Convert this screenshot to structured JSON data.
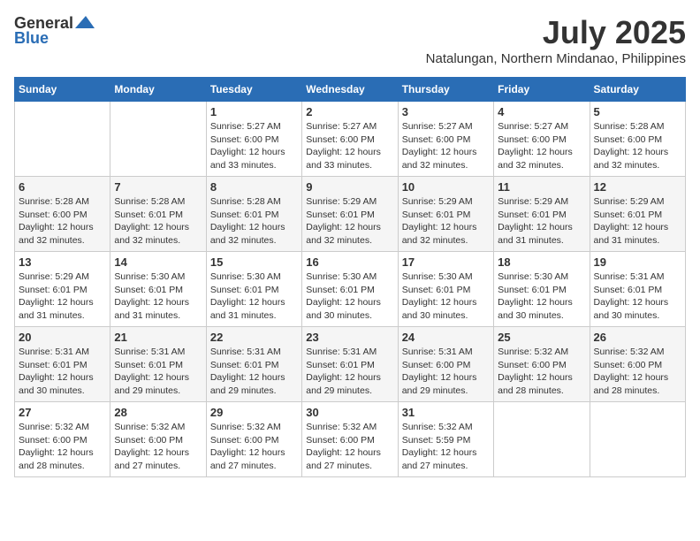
{
  "header": {
    "logo": {
      "general": "General",
      "blue": "Blue"
    },
    "title": "July 2025",
    "location": "Natalungan, Northern Mindanao, Philippines"
  },
  "weekdays": [
    "Sunday",
    "Monday",
    "Tuesday",
    "Wednesday",
    "Thursday",
    "Friday",
    "Saturday"
  ],
  "weeks": [
    [
      {
        "day": "",
        "info": ""
      },
      {
        "day": "",
        "info": ""
      },
      {
        "day": "1",
        "info": "Sunrise: 5:27 AM\nSunset: 6:00 PM\nDaylight: 12 hours and 33 minutes."
      },
      {
        "day": "2",
        "info": "Sunrise: 5:27 AM\nSunset: 6:00 PM\nDaylight: 12 hours and 33 minutes."
      },
      {
        "day": "3",
        "info": "Sunrise: 5:27 AM\nSunset: 6:00 PM\nDaylight: 12 hours and 32 minutes."
      },
      {
        "day": "4",
        "info": "Sunrise: 5:27 AM\nSunset: 6:00 PM\nDaylight: 12 hours and 32 minutes."
      },
      {
        "day": "5",
        "info": "Sunrise: 5:28 AM\nSunset: 6:00 PM\nDaylight: 12 hours and 32 minutes."
      }
    ],
    [
      {
        "day": "6",
        "info": "Sunrise: 5:28 AM\nSunset: 6:00 PM\nDaylight: 12 hours and 32 minutes."
      },
      {
        "day": "7",
        "info": "Sunrise: 5:28 AM\nSunset: 6:01 PM\nDaylight: 12 hours and 32 minutes."
      },
      {
        "day": "8",
        "info": "Sunrise: 5:28 AM\nSunset: 6:01 PM\nDaylight: 12 hours and 32 minutes."
      },
      {
        "day": "9",
        "info": "Sunrise: 5:29 AM\nSunset: 6:01 PM\nDaylight: 12 hours and 32 minutes."
      },
      {
        "day": "10",
        "info": "Sunrise: 5:29 AM\nSunset: 6:01 PM\nDaylight: 12 hours and 32 minutes."
      },
      {
        "day": "11",
        "info": "Sunrise: 5:29 AM\nSunset: 6:01 PM\nDaylight: 12 hours and 31 minutes."
      },
      {
        "day": "12",
        "info": "Sunrise: 5:29 AM\nSunset: 6:01 PM\nDaylight: 12 hours and 31 minutes."
      }
    ],
    [
      {
        "day": "13",
        "info": "Sunrise: 5:29 AM\nSunset: 6:01 PM\nDaylight: 12 hours and 31 minutes."
      },
      {
        "day": "14",
        "info": "Sunrise: 5:30 AM\nSunset: 6:01 PM\nDaylight: 12 hours and 31 minutes."
      },
      {
        "day": "15",
        "info": "Sunrise: 5:30 AM\nSunset: 6:01 PM\nDaylight: 12 hours and 31 minutes."
      },
      {
        "day": "16",
        "info": "Sunrise: 5:30 AM\nSunset: 6:01 PM\nDaylight: 12 hours and 30 minutes."
      },
      {
        "day": "17",
        "info": "Sunrise: 5:30 AM\nSunset: 6:01 PM\nDaylight: 12 hours and 30 minutes."
      },
      {
        "day": "18",
        "info": "Sunrise: 5:30 AM\nSunset: 6:01 PM\nDaylight: 12 hours and 30 minutes."
      },
      {
        "day": "19",
        "info": "Sunrise: 5:31 AM\nSunset: 6:01 PM\nDaylight: 12 hours and 30 minutes."
      }
    ],
    [
      {
        "day": "20",
        "info": "Sunrise: 5:31 AM\nSunset: 6:01 PM\nDaylight: 12 hours and 30 minutes."
      },
      {
        "day": "21",
        "info": "Sunrise: 5:31 AM\nSunset: 6:01 PM\nDaylight: 12 hours and 29 minutes."
      },
      {
        "day": "22",
        "info": "Sunrise: 5:31 AM\nSunset: 6:01 PM\nDaylight: 12 hours and 29 minutes."
      },
      {
        "day": "23",
        "info": "Sunrise: 5:31 AM\nSunset: 6:01 PM\nDaylight: 12 hours and 29 minutes."
      },
      {
        "day": "24",
        "info": "Sunrise: 5:31 AM\nSunset: 6:00 PM\nDaylight: 12 hours and 29 minutes."
      },
      {
        "day": "25",
        "info": "Sunrise: 5:32 AM\nSunset: 6:00 PM\nDaylight: 12 hours and 28 minutes."
      },
      {
        "day": "26",
        "info": "Sunrise: 5:32 AM\nSunset: 6:00 PM\nDaylight: 12 hours and 28 minutes."
      }
    ],
    [
      {
        "day": "27",
        "info": "Sunrise: 5:32 AM\nSunset: 6:00 PM\nDaylight: 12 hours and 28 minutes."
      },
      {
        "day": "28",
        "info": "Sunrise: 5:32 AM\nSunset: 6:00 PM\nDaylight: 12 hours and 27 minutes."
      },
      {
        "day": "29",
        "info": "Sunrise: 5:32 AM\nSunset: 6:00 PM\nDaylight: 12 hours and 27 minutes."
      },
      {
        "day": "30",
        "info": "Sunrise: 5:32 AM\nSunset: 6:00 PM\nDaylight: 12 hours and 27 minutes."
      },
      {
        "day": "31",
        "info": "Sunrise: 5:32 AM\nSunset: 5:59 PM\nDaylight: 12 hours and 27 minutes."
      },
      {
        "day": "",
        "info": ""
      },
      {
        "day": "",
        "info": ""
      }
    ]
  ]
}
